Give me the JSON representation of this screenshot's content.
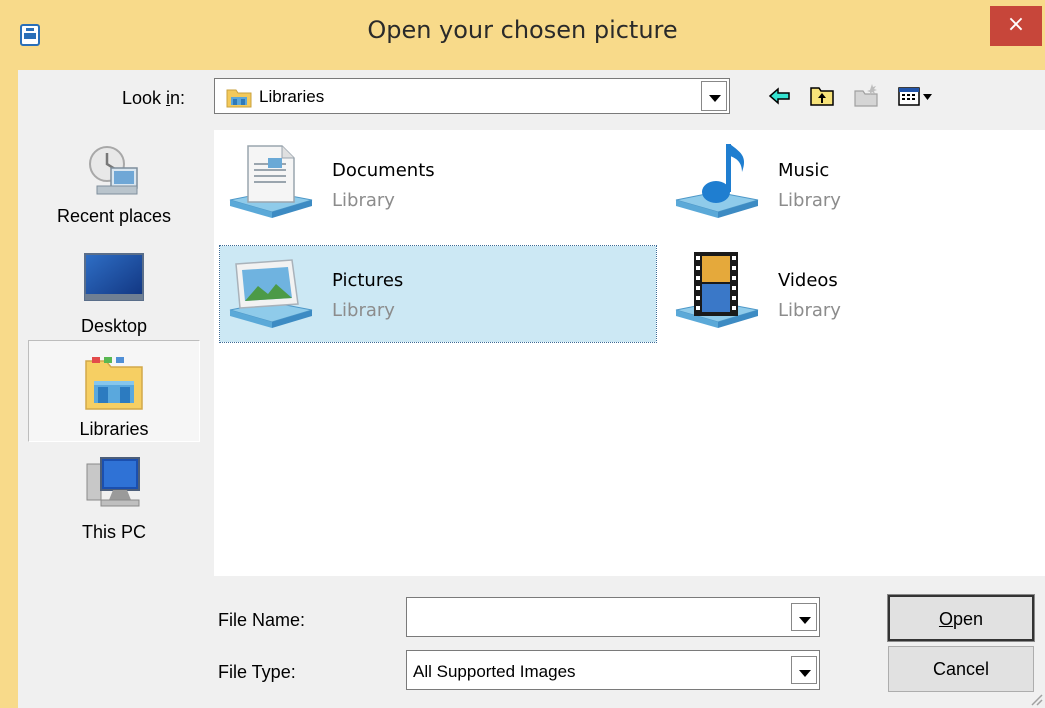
{
  "window": {
    "title": "Open your chosen picture",
    "close_label": "×"
  },
  "toolbar": {
    "look_in_label_pre": "Look ",
    "look_in_label_accel": "i",
    "look_in_label_post": "n:",
    "look_in_value": "Libraries",
    "back_icon": "back-arrow-icon",
    "up_icon": "up-folder-icon",
    "new_folder_icon": "new-folder-icon",
    "view_icon": "view-menu-icon"
  },
  "places": [
    {
      "label": "Recent places",
      "icon": "recent-places-icon"
    },
    {
      "label": "Desktop",
      "icon": "desktop-icon"
    },
    {
      "label": "Libraries",
      "icon": "libraries-icon",
      "selected": true
    },
    {
      "label": "This PC",
      "icon": "this-pc-icon"
    }
  ],
  "files": [
    {
      "name": "Documents",
      "type": "Library",
      "icon": "documents-library-icon"
    },
    {
      "name": "Music",
      "type": "Library",
      "icon": "music-library-icon"
    },
    {
      "name": "Pictures",
      "type": "Library",
      "icon": "pictures-library-icon",
      "selected": true
    },
    {
      "name": "Videos",
      "type": "Library",
      "icon": "videos-library-icon"
    }
  ],
  "form": {
    "file_name_label": "File Name:",
    "file_name_value": "",
    "file_type_label": "File Type:",
    "file_type_value": "All Supported Images"
  },
  "buttons": {
    "open_accel": "O",
    "open_rest": "pen",
    "cancel": "Cancel"
  },
  "colors": {
    "frame": "#F8DA8A",
    "close": "#C7463A",
    "selection": "#CCE8F4"
  }
}
